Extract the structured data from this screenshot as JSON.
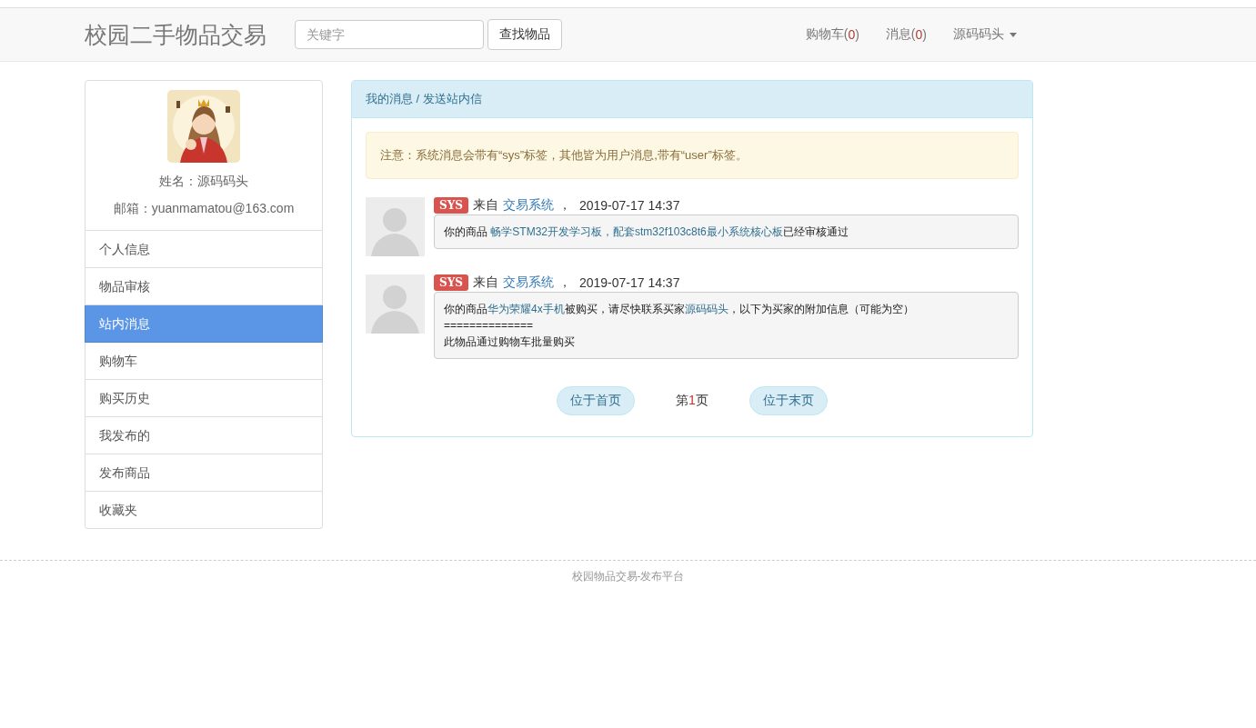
{
  "navbar": {
    "brand": "校园二手物品交易",
    "search": {
      "placeholder": "关键字"
    },
    "search_button": "查找物品",
    "links": [
      {
        "label": "购物车",
        "open": "(",
        "count": "0",
        "close": ")",
        "dropdown": false
      },
      {
        "label": "消息",
        "open": "(",
        "count": "0",
        "close": ")",
        "dropdown": false
      },
      {
        "label": "源码码头",
        "dropdown": true
      }
    ]
  },
  "profile": {
    "name": "姓名：源码码头",
    "email": "邮箱：yuanmamatou@163.com"
  },
  "sidebar": {
    "items": [
      {
        "label": "个人信息",
        "selected": false
      },
      {
        "label": "物品审核",
        "selected": false
      },
      {
        "label": "站内消息",
        "selected": true
      },
      {
        "label": "购物车",
        "selected": false
      },
      {
        "label": "购买历史",
        "selected": false
      },
      {
        "label": "我发布的",
        "selected": false
      },
      {
        "label": "发布商品",
        "selected": false
      },
      {
        "label": "收藏夹",
        "selected": false
      }
    ]
  },
  "panel": {
    "heading": "我的消息 / 发送站内信",
    "notice": "注意：系统消息会带有“sys”标签，其他皆为用户消息,带有“user”标签。",
    "messages": [
      {
        "tag": "SYS",
        "from_prefix": "来自",
        "sender": "交易系统",
        "sep": "，",
        "time": "2019-07-17 14:37",
        "lines": [
          [
            {
              "text": "你的商品 ",
              "link": false
            },
            {
              "text": "畅学STM32开发学习板，配套stm32f103c8t6最小系统核心板",
              "link": true
            },
            {
              "text": "已经审核通过",
              "link": false
            }
          ]
        ]
      },
      {
        "tag": "SYS",
        "from_prefix": "来自",
        "sender": "交易系统",
        "sep": "，",
        "time": "2019-07-17 14:37",
        "lines": [
          [
            {
              "text": "你的商品",
              "link": false
            },
            {
              "text": "华为荣耀4x手机",
              "link": true
            },
            {
              "text": "被购买，请尽快联系买家",
              "link": false
            },
            {
              "text": "源码码头",
              "link": true
            },
            {
              "text": "，以下为买家的附加信息（可能为空）",
              "link": false
            }
          ],
          [
            {
              "text": "==============",
              "link": false
            }
          ],
          [
            {
              "text": "此物品通过购物车批量购买",
              "link": false
            }
          ]
        ]
      }
    ],
    "pager": {
      "first": "位于首页",
      "prefix": "第",
      "page": "1",
      "suffix": "页",
      "last": "位于末页"
    }
  },
  "footer": "校园物品交易-发布平台"
}
